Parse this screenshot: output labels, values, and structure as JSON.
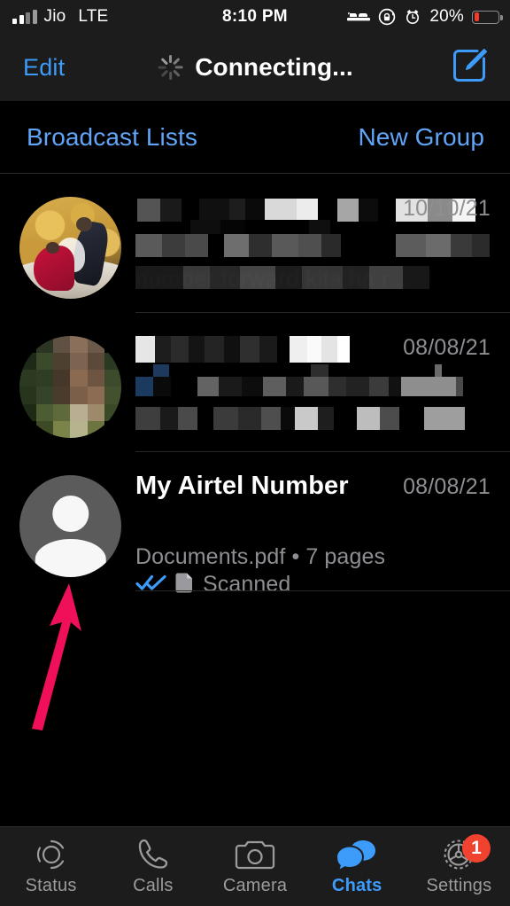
{
  "status_bar": {
    "carrier": "Jio",
    "network_type": "LTE",
    "time": "8:10 PM",
    "battery_percent": "20%",
    "battery_level": 20,
    "icons": [
      "signal-bars-icon",
      "bed-icon",
      "rotation-lock-icon",
      "alarm-clock-icon",
      "battery-icon"
    ]
  },
  "nav_bar": {
    "edit_label": "Edit",
    "title": "Connecting...",
    "compose_icon": "compose-icon",
    "spinner_icon": "loading-spinner-icon"
  },
  "action_row": {
    "broadcast_lists_label": "Broadcast Lists",
    "new_group_label": "New Group"
  },
  "chats": [
    {
      "avatar_type": "photo-wedding",
      "name": "",
      "name_redacted": true,
      "date": "10/10/21",
      "preview_line1": "",
      "preview_line1_redacted": true,
      "preview_line2": "number forward kita ha r...",
      "preview_line2_redacted": true
    },
    {
      "avatar_type": "photo-censored",
      "name": "",
      "name_redacted": true,
      "date": "08/08/21",
      "preview_line1": "",
      "preview_line1_redacted": true,
      "preview_line2": "",
      "preview_line2_redacted": true
    },
    {
      "avatar_type": "default-person",
      "name": "My Airtel Number",
      "name_redacted": false,
      "date": "08/08/21",
      "status_icon": "double-check-read-icon",
      "doc_icon": "document-icon",
      "preview_line1": "Scanned",
      "preview_line2": "Documents.pdf • 7 pages",
      "preview_line1_redacted": false,
      "preview_line2_redacted": false
    }
  ],
  "annotation": {
    "type": "arrow",
    "direction": "up",
    "color": "#F0105A",
    "points_to": "default-person-avatar"
  },
  "tab_bar": {
    "tabs": [
      {
        "label": "Status",
        "icon": "status-rings-icon",
        "active": false,
        "badge": ""
      },
      {
        "label": "Calls",
        "icon": "phone-icon",
        "active": false,
        "badge": ""
      },
      {
        "label": "Camera",
        "icon": "camera-icon",
        "active": false,
        "badge": ""
      },
      {
        "label": "Chats",
        "icon": "chat-bubbles-icon",
        "active": true,
        "badge": ""
      },
      {
        "label": "Settings",
        "icon": "gear-icon",
        "active": false,
        "badge": "1"
      }
    ]
  },
  "colors": {
    "accent_blue": "#3D9BFA",
    "link_blue": "#60A5F7",
    "background": "#000000",
    "bar_background": "#1C1C1C",
    "secondary_text": "#8E8E93",
    "badge_red": "#F0422E",
    "battery_red": "#F03B2D",
    "arrow_pink": "#F0105A"
  }
}
